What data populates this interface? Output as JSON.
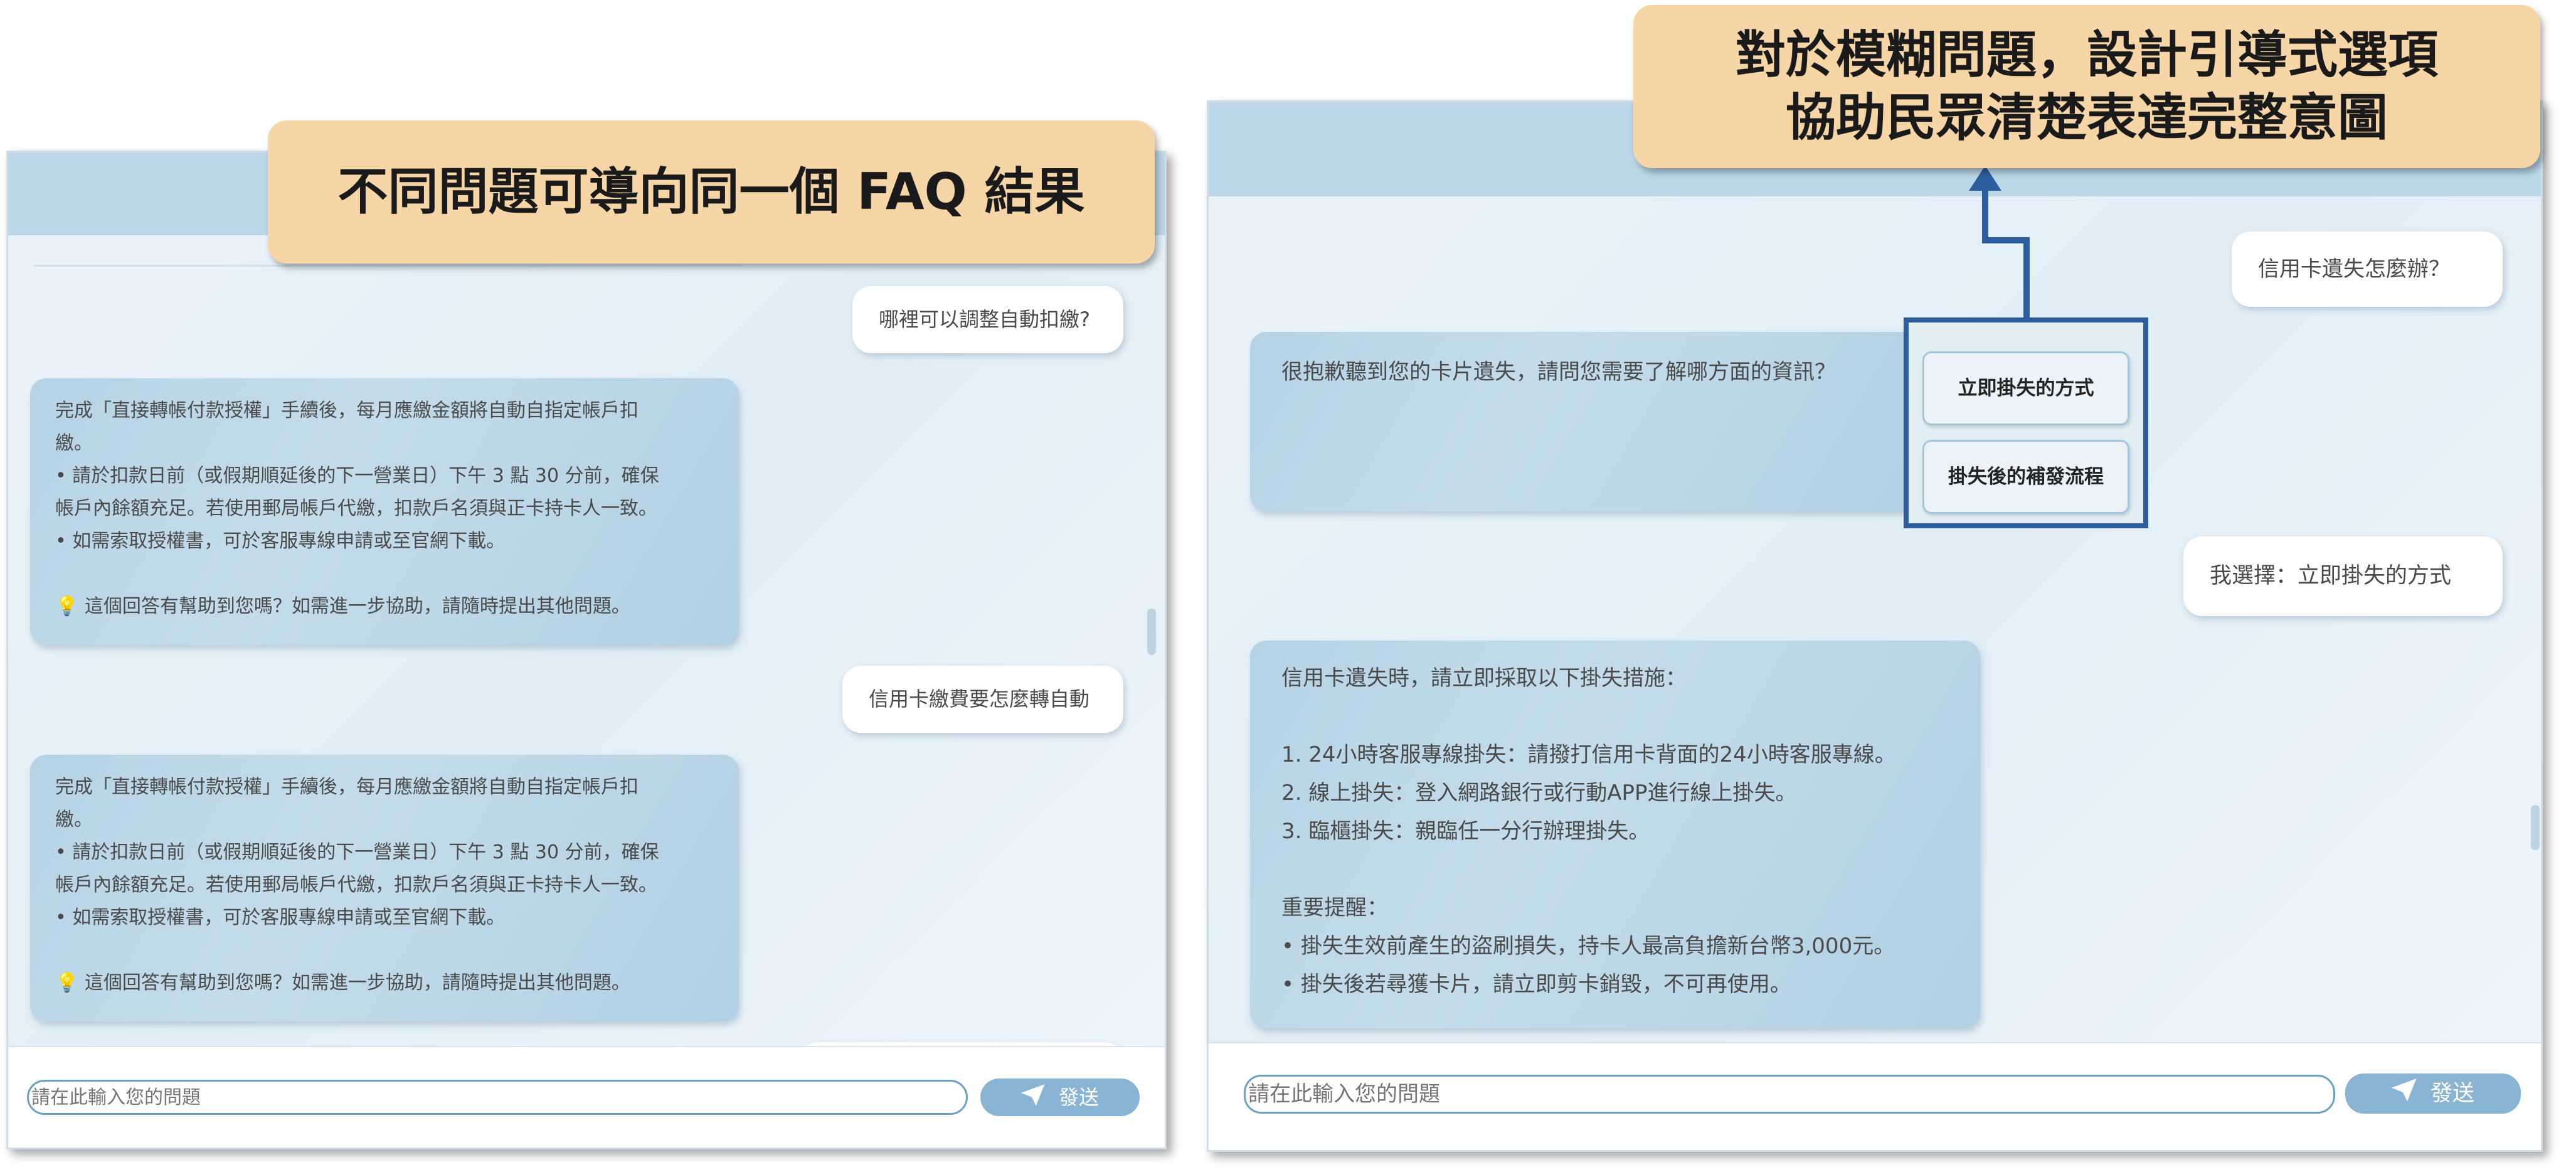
{
  "left_panel": {
    "callout": "不同問題可導向同一個 FAQ 結果",
    "messages": {
      "user_1": "哪裡可以調整自動扣繳?",
      "bot_1": "完成「直接轉帳付款授權」手續後，每月應繳金額將自動自指定帳戶扣\n繳。\n• 請於扣款日前（或假期順延後的下一營業日）下午 3 點 30 分前，確保\n帳戶內餘額充足。若使用郵局帳戶代繳，扣款戶名須與正卡持卡人一致。\n• 如需索取授權書，可於客服專線申請或至官網下載。\n\n💡 這個回答有幫助到您嗎？如需進一步協助，請隨時提出其他問題。",
      "user_2": "信用卡繳費要怎麼轉自動",
      "bot_2": "完成「直接轉帳付款授權」手續後，每月應繳金額將自動自指定帳戶扣\n繳。\n• 請於扣款日前（或假期順延後的下一營業日）下午 3 點 30 分前，確保\n帳戶內餘額充足。若使用郵局帳戶代繳，扣款戶名須與正卡持卡人一致。\n• 如需索取授權書，可於客服專線申請或至官網下載。\n\n💡 這個回答有幫助到您嗎？如需進一步協助，請隨時提出其他問題。"
    },
    "input_placeholder": "請在此輸入您的問題",
    "send_label": "發送"
  },
  "right_panel": {
    "callout_line1": "對於模糊問題，設計引導式選項",
    "callout_line2": "協助民眾清楚表達完整意圖",
    "messages": {
      "user_1": "信用卡遺失怎麼辦？",
      "bot_1": "很抱歉聽到您的卡片遺失，請問您需要了解哪方面的資訊？",
      "option_1": "立即掛失的方式",
      "option_2": "掛失後的補發流程",
      "user_2": "我選擇：立即掛失的方式",
      "bot_2": "信用卡遺失時，請立即採取以下掛失措施：\n\n1. 24小時客服專線掛失：請撥打信用卡背面的24小時客服專線。\n2. 線上掛失：登入網路銀行或行動APP進行線上掛失。\n3. 臨櫃掛失：親臨任一分行辦理掛失。\n\n重要提醒：\n• 掛失生效前產生的盜刷損失，持卡人最高負擔新台幣3,000元。\n• 掛失後若尋獲卡片，請立即剪卡銷毀，不可再使用。"
    },
    "input_placeholder": "請在此輸入您的問題",
    "send_label": "發送"
  },
  "colors": {
    "callout_bg": "#f6d6a6",
    "highlight_blue": "#2d5f9e",
    "send_button": "#8ab4d3",
    "bot_bubble": "#b5d3e6"
  },
  "icons": {
    "send": "paper-plane-icon",
    "hint": "lightbulb-icon"
  }
}
